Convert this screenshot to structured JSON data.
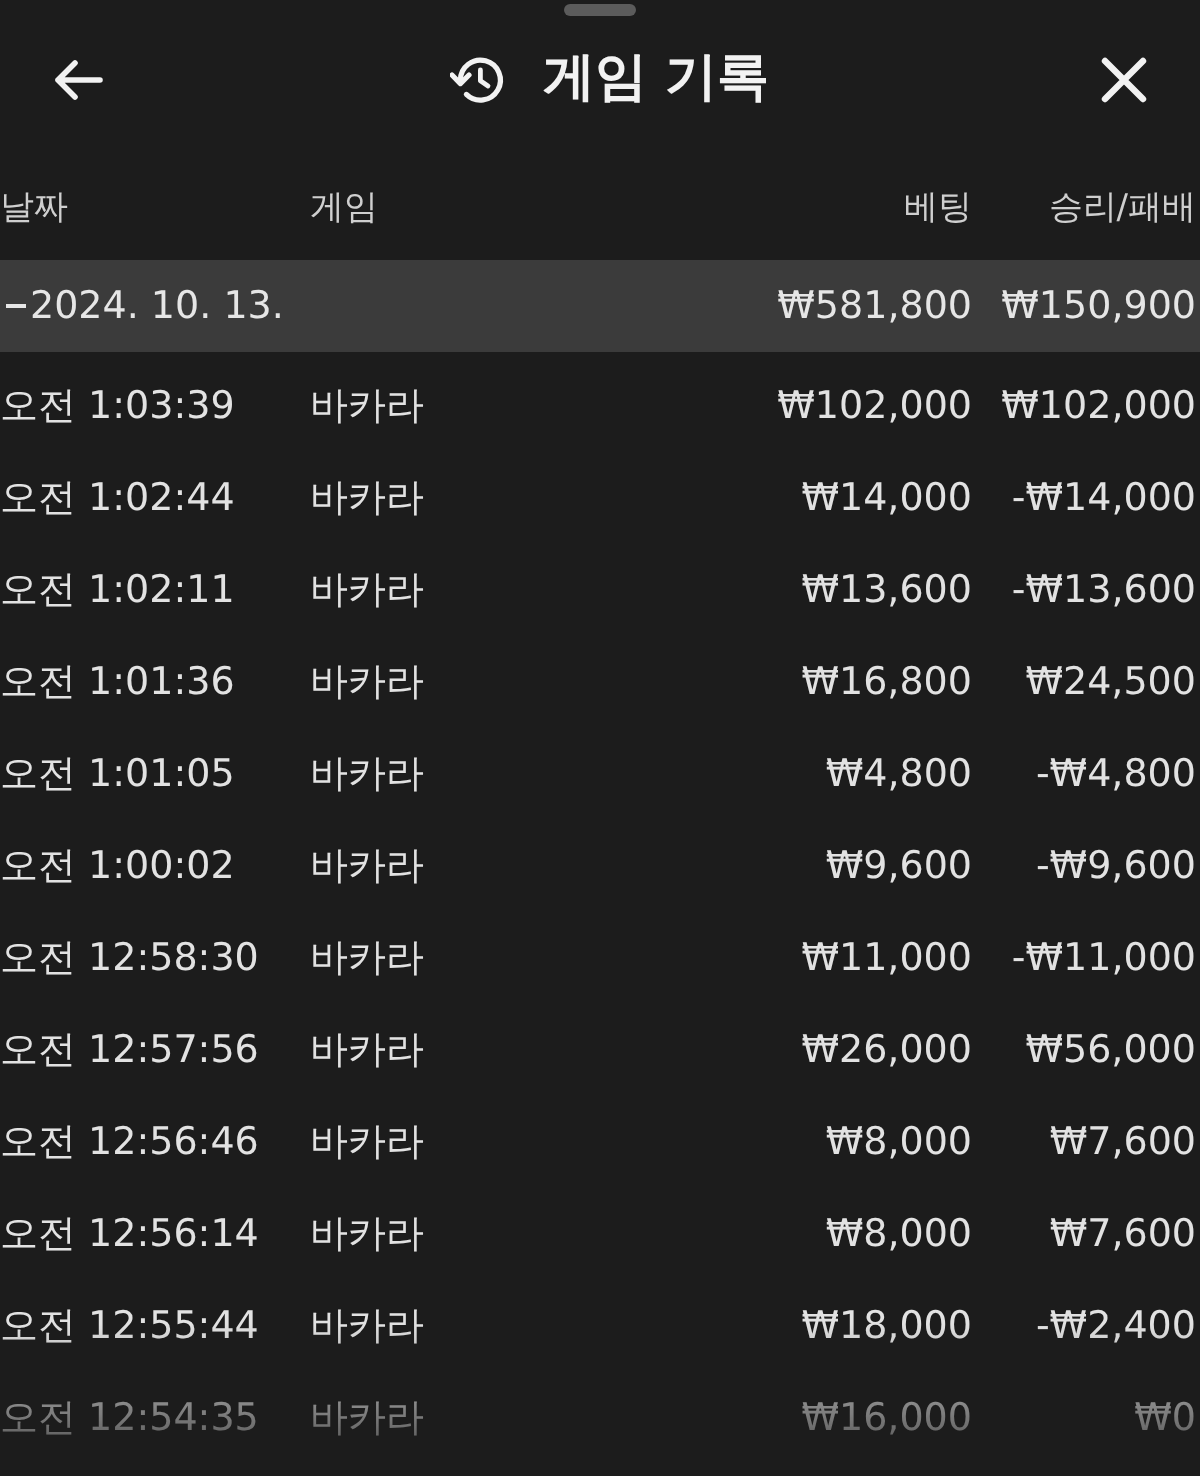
{
  "header": {
    "title": "게임 기록"
  },
  "table": {
    "columns": [
      "날짜",
      "게임",
      "베팅",
      "승리/패배"
    ],
    "groups": [
      {
        "date": "2024. 10. 13.",
        "expanded": true,
        "bet_total": "₩581,800",
        "result_total": "₩150,900",
        "rows": [
          {
            "time": "오전 1:03:39",
            "game": "바카라",
            "bet": "₩102,000",
            "result": "₩102,000"
          },
          {
            "time": "오전 1:02:44",
            "game": "바카라",
            "bet": "₩14,000",
            "result": "-₩14,000"
          },
          {
            "time": "오전 1:02:11",
            "game": "바카라",
            "bet": "₩13,600",
            "result": "-₩13,600"
          },
          {
            "time": "오전 1:01:36",
            "game": "바카라",
            "bet": "₩16,800",
            "result": "₩24,500"
          },
          {
            "time": "오전 1:01:05",
            "game": "바카라",
            "bet": "₩4,800",
            "result": "-₩4,800"
          },
          {
            "time": "오전 1:00:02",
            "game": "바카라",
            "bet": "₩9,600",
            "result": "-₩9,600"
          },
          {
            "time": "오전 12:58:30",
            "game": "바카라",
            "bet": "₩11,000",
            "result": "-₩11,000"
          },
          {
            "time": "오전 12:57:56",
            "game": "바카라",
            "bet": "₩26,000",
            "result": "₩56,000"
          },
          {
            "time": "오전 12:56:46",
            "game": "바카라",
            "bet": "₩8,000",
            "result": "₩7,600"
          },
          {
            "time": "오전 12:56:14",
            "game": "바카라",
            "bet": "₩8,000",
            "result": "₩7,600"
          },
          {
            "time": "오전 12:55:44",
            "game": "바카라",
            "bet": "₩18,000",
            "result": "-₩2,400"
          },
          {
            "time": "오전 12:54:35",
            "game": "바카라",
            "bet": "₩16,000",
            "result": "₩0"
          }
        ]
      }
    ]
  }
}
